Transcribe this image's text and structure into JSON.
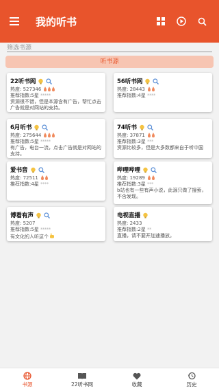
{
  "app": {
    "title": "我的听书"
  },
  "filter": {
    "placeholder": "筛选书源"
  },
  "source_bar": {
    "label": "听书源"
  },
  "cards": [
    {
      "name": "22听书网",
      "heat": "热度: 527346",
      "flames": 3,
      "rec": "推荐指数:5星",
      "stars": "*****",
      "desc": "资源很不错，但是本源含有广告，帮忙点击广告就是对网站的支持。"
    },
    {
      "name": "56听书网",
      "heat": "热度: 28443",
      "flames": 2,
      "rec": "推荐指数:4星",
      "stars": "****",
      "desc": ""
    },
    {
      "name": "6月听书",
      "heat": "热度: 275644",
      "flames": 3,
      "rec": "推荐指数:5星",
      "stars": "*****",
      "desc": "有广告，电台一流，点击广告就是对网站的支持。"
    },
    {
      "name": "74听书",
      "heat": "热度: 37871",
      "flames": 2,
      "rec": "推荐指数:3星",
      "stars": "***",
      "desc": "资源比较多，但是大多数都来自于听中国"
    },
    {
      "name": "爱书音",
      "heat": "热度: 72511",
      "flames": 2,
      "rec": "推荐指数:4星",
      "stars": "****",
      "desc": ""
    },
    {
      "name": "哔哩哔哩",
      "heat": "热度: 19289",
      "flames": 2,
      "rec": "推荐指数:3星",
      "stars": "***",
      "desc": "b站也有一些有声小说，此源只做了搜索，不含发现。"
    },
    {
      "name": "博看有声",
      "heat": "热度: 5207",
      "flames": 0,
      "rec": "推荐指数:5星",
      "stars": "*****",
      "desc": "有文化的人听这个"
    },
    {
      "name": "电视直播",
      "heat": "热度: 2433",
      "flames": 0,
      "rec": "推荐指数:2星",
      "stars": "**",
      "desc": "直播，请不要开加速播放。"
    }
  ],
  "tabs": [
    {
      "label": "书源",
      "icon": "globe-icon"
    },
    {
      "label": "22听书网",
      "icon": "book-icon"
    },
    {
      "label": "收藏",
      "icon": "heart-icon"
    },
    {
      "label": "历史",
      "icon": "history-icon"
    }
  ],
  "colors": {
    "primary": "#e8542c",
    "source_bar_bg": "#f7c5b2",
    "flame": "#f08a5d",
    "bulb": "#f5c342"
  }
}
